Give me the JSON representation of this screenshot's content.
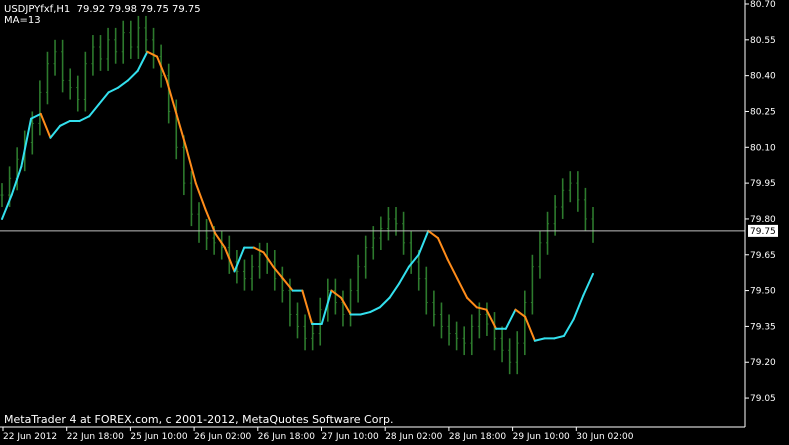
{
  "header": {
    "symbol_line": "USDJPYfxf,H1  79.92 79.98 79.75 79.75",
    "indicator_line": "MA=13"
  },
  "footer": {
    "copyright": "MetaTrader 4 at FOREX.com, c 2001-2012, MetaQuotes Software Corp."
  },
  "colors": {
    "background": "#000000",
    "axis": "#ffffff",
    "candles": "#2d7a2d",
    "ma_up": "#33e0ee",
    "ma_down": "#ff8c1a",
    "price_line": "#c0c0c0",
    "price_tag_bg": "#ffffff",
    "price_tag_text": "#000000"
  },
  "chart_data": {
    "type": "line",
    "title": "USDJPYfxf,H1",
    "ylim": [
      79.0,
      80.7
    ],
    "y_ticks": [
      "80.70",
      "80.55",
      "80.40",
      "80.25",
      "80.10",
      "79.95",
      "79.80",
      "79.65",
      "79.50",
      "79.35",
      "79.20",
      "79.05"
    ],
    "x_ticks": [
      "22 Jun 2012",
      "22 Jun 18:00",
      "25 Jun 10:00",
      "26 Jun 02:00",
      "26 Jun 18:00",
      "27 Jun 10:00",
      "28 Jun 02:00",
      "28 Jun 18:00",
      "29 Jun 10:00",
      "30 Jun 02:00"
    ],
    "current_price": "79.75",
    "grid": false,
    "candles_close": [
      79.9,
      79.97,
      80.05,
      80.12,
      80.2,
      80.33,
      80.45,
      80.5,
      80.38,
      80.35,
      80.3,
      80.45,
      80.52,
      80.47,
      80.55,
      80.5,
      80.58,
      80.52,
      80.6,
      80.55,
      80.48,
      80.4,
      80.25,
      80.1,
      79.95,
      79.82,
      79.75,
      79.72,
      79.7,
      79.68,
      79.62,
      79.58,
      79.55,
      79.6,
      79.65,
      79.62,
      79.55,
      79.5,
      79.4,
      79.35,
      79.3,
      79.32,
      79.42,
      79.5,
      79.45,
      79.4,
      79.5,
      79.6,
      79.68,
      79.72,
      79.76,
      79.8,
      79.78,
      79.7,
      79.62,
      79.55,
      79.45,
      79.4,
      79.35,
      79.32,
      79.3,
      79.28,
      79.35,
      79.4,
      79.36,
      79.3,
      79.25,
      79.2,
      79.28,
      79.45,
      79.6,
      79.7,
      79.78,
      79.85,
      79.92,
      79.95,
      79.88,
      79.8,
      79.75
    ],
    "series": [
      {
        "name": "MA=13",
        "values": [
          79.8,
          79.9,
          80.02,
          80.22,
          80.24,
          80.14,
          80.19,
          80.21,
          80.21,
          80.23,
          80.28,
          80.33,
          80.35,
          80.38,
          80.42,
          80.5,
          80.48,
          80.38,
          80.24,
          80.1,
          79.95,
          79.84,
          79.74,
          79.68,
          79.58,
          79.68,
          79.68,
          79.66,
          79.6,
          79.55,
          79.5,
          79.5,
          79.36,
          79.36,
          79.5,
          79.47,
          79.4,
          79.4,
          79.41,
          79.43,
          79.47,
          79.53,
          79.6,
          79.65,
          79.75,
          79.72,
          79.63,
          79.55,
          79.47,
          79.43,
          79.42,
          79.34,
          79.34,
          79.42,
          79.39,
          79.29,
          79.3,
          79.3,
          79.31,
          79.38,
          79.48,
          79.57
        ]
      }
    ]
  }
}
